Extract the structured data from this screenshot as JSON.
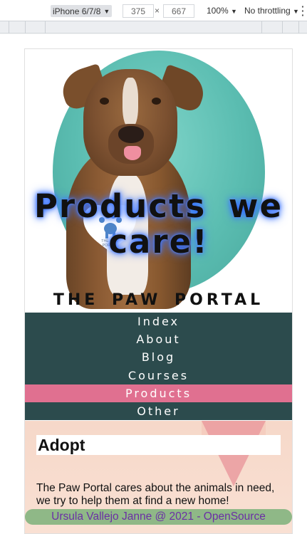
{
  "devtools": {
    "device": "iPhone 6/7/8",
    "width": "375",
    "times": "×",
    "height": "667",
    "zoom": "100%",
    "throttling": "No throttling"
  },
  "hero": {
    "title": "Products we care!",
    "logo_text": "THE PAW PORTAL",
    "brand": "THE PAW PORTAL"
  },
  "nav": {
    "items": [
      {
        "label": "Index"
      },
      {
        "label": "About"
      },
      {
        "label": "Blog"
      },
      {
        "label": "Courses"
      },
      {
        "label": "Products"
      },
      {
        "label": "Other"
      }
    ],
    "active": "Products"
  },
  "section": {
    "title": "Adopt",
    "text": "The Paw Portal cares about the animals in need, we try to help them at find a new home!"
  },
  "footer": {
    "text": "Ursula Vallejo Janne @ 2021 - OpenSource"
  },
  "colors": {
    "nav_bg": "#2c4b4d",
    "nav_active": "#e07090",
    "teal": "#5bbdb1",
    "footer_bg": "#8fb887",
    "footer_text": "#6b2fa5"
  }
}
